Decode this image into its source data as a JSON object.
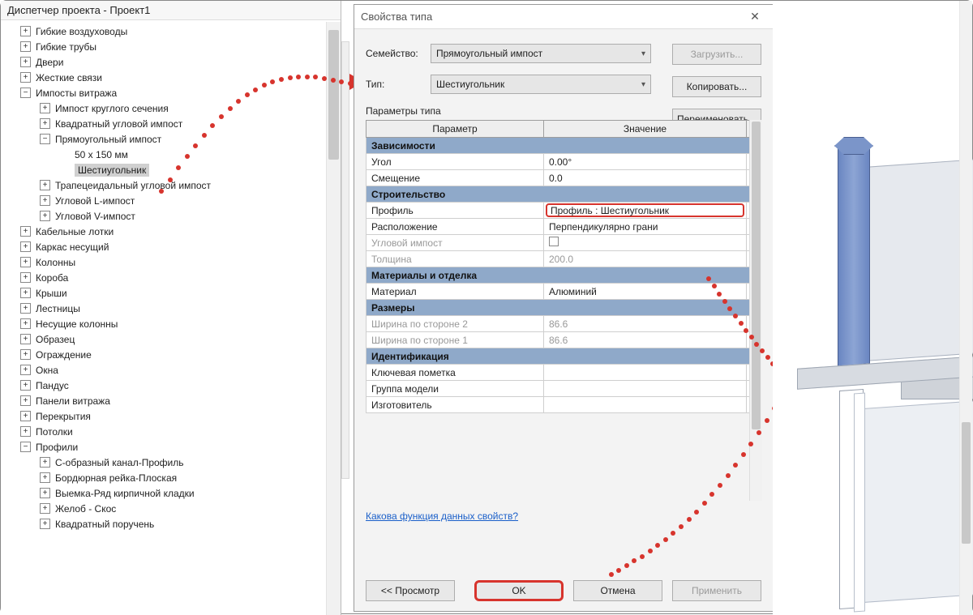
{
  "browser": {
    "title": "Диспетчер проекта - Проект1",
    "items": [
      {
        "lvl": 1,
        "exp": "+",
        "label": "Гибкие воздуховоды"
      },
      {
        "lvl": 1,
        "exp": "+",
        "label": "Гибкие трубы"
      },
      {
        "lvl": 1,
        "exp": "+",
        "label": "Двери"
      },
      {
        "lvl": 1,
        "exp": "+",
        "label": "Жесткие связи"
      },
      {
        "lvl": 1,
        "exp": "−",
        "label": "Импосты витража"
      },
      {
        "lvl": 2,
        "exp": "+",
        "label": "Импост круглого сечения"
      },
      {
        "lvl": 2,
        "exp": "+",
        "label": "Квадратный угловой импост"
      },
      {
        "lvl": 2,
        "exp": "−",
        "label": "Прямоугольный импост"
      },
      {
        "lvl": 3,
        "exp": " ",
        "label": "50 x 150 мм"
      },
      {
        "lvl": 3,
        "exp": " ",
        "label": "Шестиугольник",
        "selected": true
      },
      {
        "lvl": 2,
        "exp": "+",
        "label": "Трапецеидальный угловой импост"
      },
      {
        "lvl": 2,
        "exp": "+",
        "label": "Угловой L-импост"
      },
      {
        "lvl": 2,
        "exp": "+",
        "label": "Угловой V-импост"
      },
      {
        "lvl": 1,
        "exp": "+",
        "label": "Кабельные лотки"
      },
      {
        "lvl": 1,
        "exp": "+",
        "label": "Каркас несущий"
      },
      {
        "lvl": 1,
        "exp": "+",
        "label": "Колонны"
      },
      {
        "lvl": 1,
        "exp": "+",
        "label": "Короба"
      },
      {
        "lvl": 1,
        "exp": "+",
        "label": "Крыши"
      },
      {
        "lvl": 1,
        "exp": "+",
        "label": "Лестницы"
      },
      {
        "lvl": 1,
        "exp": "+",
        "label": "Несущие колонны"
      },
      {
        "lvl": 1,
        "exp": "+",
        "label": "Образец"
      },
      {
        "lvl": 1,
        "exp": "+",
        "label": "Ограждение"
      },
      {
        "lvl": 1,
        "exp": "+",
        "label": "Окна"
      },
      {
        "lvl": 1,
        "exp": "+",
        "label": "Пандус"
      },
      {
        "lvl": 1,
        "exp": "+",
        "label": "Панели витража"
      },
      {
        "lvl": 1,
        "exp": "+",
        "label": "Перекрытия"
      },
      {
        "lvl": 1,
        "exp": "+",
        "label": "Потолки"
      },
      {
        "lvl": 1,
        "exp": "−",
        "label": "Профили"
      },
      {
        "lvl": 2,
        "exp": "+",
        "label": "C-образный канал-Профиль"
      },
      {
        "lvl": 2,
        "exp": "+",
        "label": "Бордюрная рейка-Плоская"
      },
      {
        "lvl": 2,
        "exp": "+",
        "label": "Выемка-Ряд кирпичной кладки"
      },
      {
        "lvl": 2,
        "exp": "+",
        "label": "Желоб - Скос"
      },
      {
        "lvl": 2,
        "exp": "+",
        "label": "Квадратный поручень"
      }
    ]
  },
  "dialog": {
    "title": "Свойства типа",
    "labels": {
      "family": "Семейство:",
      "type": "Тип:",
      "type_params": "Параметры типа"
    },
    "family_value": "Прямоугольный импост",
    "type_value": "Шестиугольник",
    "buttons": {
      "load": "Загрузить...",
      "copy": "Копировать...",
      "rename": "Переименовать...",
      "preview": "<<  Просмотр",
      "ok": "OK",
      "cancel": "Отмена",
      "apply": "Применить"
    },
    "headers": {
      "param": "Параметр",
      "value": "Значение",
      "eq": "="
    },
    "groups": [
      {
        "title": "Зависимости",
        "rows": [
          {
            "name": "Угол",
            "value": "0.00°"
          },
          {
            "name": "Смещение",
            "value": "0.0"
          }
        ]
      },
      {
        "title": "Строительство",
        "rows": [
          {
            "name": "Профиль",
            "value": "Профиль : Шестиугольник",
            "hl": true
          },
          {
            "name": "Расположение",
            "value": "Перпендикулярно грани"
          },
          {
            "name": "Угловой импост",
            "value": "",
            "gray": true,
            "checkbox": true
          },
          {
            "name": "Толщина",
            "value": "200.0",
            "gray": true
          }
        ]
      },
      {
        "title": "Материалы и отделка",
        "rows": [
          {
            "name": "Материал",
            "value": "Алюминий"
          }
        ]
      },
      {
        "title": "Размеры",
        "rows": [
          {
            "name": "Ширина по стороне 2",
            "value": "86.6",
            "gray": true
          },
          {
            "name": "Ширина по стороне 1",
            "value": "86.6",
            "gray": true
          }
        ]
      },
      {
        "title": "Идентификация",
        "rows": [
          {
            "name": "Ключевая пометка",
            "value": ""
          },
          {
            "name": "Группа модели",
            "value": ""
          },
          {
            "name": "Изготовитель",
            "value": ""
          }
        ]
      }
    ],
    "help_link": "Какова функция данных свойств?"
  }
}
